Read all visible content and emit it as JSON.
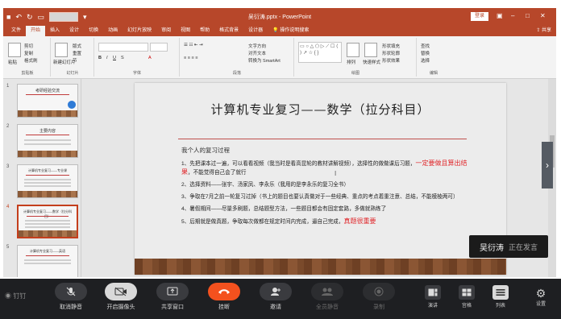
{
  "app": {
    "doc_title": "吴衍涛.pptx - PowerPoint",
    "login": "登录",
    "share": "共享",
    "tell_me": "操作说明搜索"
  },
  "tabs": [
    "文件",
    "开始",
    "插入",
    "设计",
    "切换",
    "动画",
    "幻灯片放映",
    "审阅",
    "视图",
    "帮助",
    "格式背景",
    "设计器"
  ],
  "ribbon": {
    "clipboard": {
      "paste": "粘贴",
      "cut": "剪切",
      "copy": "复制",
      "format_painter": "格式刷",
      "group": "剪贴板"
    },
    "slides": {
      "new_slide": "新建幻灯片",
      "layout": "版式",
      "reset": "重置",
      "section": "节",
      "group": "幻灯片"
    },
    "font": {
      "group": "字体"
    },
    "paragraph": {
      "text_direction": "文字方向",
      "align_text": "对齐文本",
      "smartart": "转换为 SmartArt",
      "group": "段落"
    },
    "drawing": {
      "arrange": "排列",
      "quick_styles": "快速样式",
      "shape_fill": "形状填充",
      "shape_outline": "形状轮廓",
      "shape_effects": "形状效果",
      "group": "绘图"
    },
    "editing": {
      "find": "查找",
      "replace": "替换",
      "select": "选择",
      "group": "编辑"
    }
  },
  "thumbnails": [
    {
      "num": "1",
      "title": "考研经验交流"
    },
    {
      "num": "2",
      "title": "主要内容"
    },
    {
      "num": "3",
      "title": "计算机专业复习——专业课"
    },
    {
      "num": "4",
      "title": "计算机专业复习——数学（拉分科目）"
    },
    {
      "num": "5",
      "title": "计算机专业复习——英语"
    }
  ],
  "slide": {
    "title": "计算机专业复习——数学（拉分科目）",
    "heading": "我个人的复习过程",
    "items": [
      {
        "n": "1、",
        "text": "先把课本过一遍，可以看看视频（我当时是看高昆轮的教材讲解视频），选择性的做做课后习题，",
        "red": "一定要做且算出结果",
        "tail": "，不能觉得自己会了就行"
      },
      {
        "n": "2、",
        "text": "选择资料——张宇、汤家凤、李永乐（我用的是李永乐的复习全书）",
        "red": "",
        "tail": ""
      },
      {
        "n": "3、",
        "text": "争取在7月之前一轮复习过掉（书上的题目也要认真做对于一些经典、重点的考点着重注意、总结，不能模棱两可）",
        "red": "",
        "tail": ""
      },
      {
        "n": "4、",
        "text": "暑假期间——尽量多刷题，总结题型方法，一些题目都会有固定套路，多做就熟练了",
        "red": "",
        "tail": ""
      },
      {
        "n": "5、",
        "text": "后期就是做真题，争取每次做都在规定时间内完成，逼自己完成，",
        "red": "真题很重要",
        "tail": ""
      }
    ]
  },
  "speaker": {
    "name": "吴衍涛",
    "status": "正在发言"
  },
  "bottombar": {
    "logo": "钉钉",
    "controls": [
      {
        "label": "取消静音",
        "icon": "mic-muted-icon"
      },
      {
        "label": "开启摄像头",
        "icon": "camera-off-icon"
      },
      {
        "label": "共享窗口",
        "icon": "share-screen-icon"
      },
      {
        "label": "挂断",
        "icon": "hangup-icon"
      },
      {
        "label": "邀请",
        "icon": "invite-icon"
      },
      {
        "label": "全员静音",
        "icon": "mute-all-icon"
      },
      {
        "label": "录制",
        "icon": "record-icon"
      }
    ],
    "views": [
      {
        "label": "演讲",
        "icon": "speaker-view-icon"
      },
      {
        "label": "宫格",
        "icon": "grid-view-icon"
      },
      {
        "label": "列表",
        "icon": "list-view-icon"
      }
    ],
    "settings": "设置"
  },
  "colors": {
    "ppt_accent": "#b7472a",
    "red_text": "#e0262a",
    "hangup": "#f4511e"
  }
}
